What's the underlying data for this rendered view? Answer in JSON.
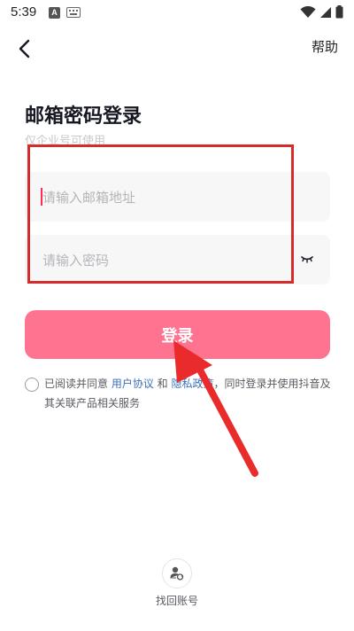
{
  "status_bar": {
    "time": "5:39",
    "notification_badge": "A"
  },
  "header": {
    "help_label": "帮助"
  },
  "main": {
    "title": "邮箱密码登录",
    "subtitle": "仅企业号可使用",
    "email_field": {
      "value": "",
      "placeholder": "请输入邮箱地址"
    },
    "password_field": {
      "value": "",
      "placeholder": "请输入密码"
    },
    "login_button_label": "登录",
    "agreement": {
      "prefix": "已阅读并同意 ",
      "user_agreement": "用户协议",
      "and": " 和 ",
      "privacy_policy": "隐私政策",
      "suffix": "，同时登录并使用抖音及其关联产品相关服务"
    }
  },
  "footer": {
    "recover_account_label": "找回账号"
  },
  "colors": {
    "accent": "#fe2c55",
    "button": "#fe7390",
    "link": "#3a6fb8",
    "annotation": "#d52b2b"
  }
}
